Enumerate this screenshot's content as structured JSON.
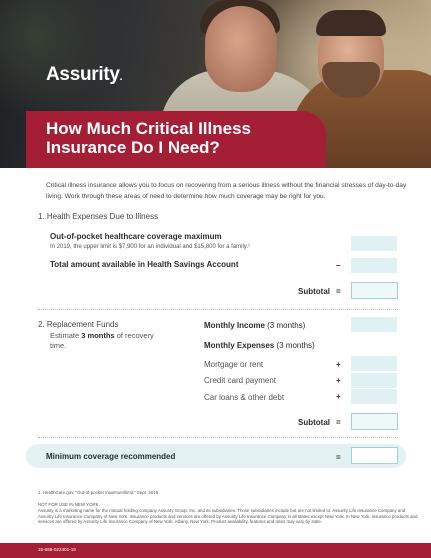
{
  "brand": {
    "logo_text": "Assurity",
    "accent_color": "#a41f35",
    "field_color": "#dff1f2"
  },
  "hero": {
    "title": "How Much Critical Illness Insurance Do I Need?",
    "image_alt": "Two men smiling"
  },
  "intro": "Critical illness insurance allows you to focus on recovering from a serious illness without the financial stresses of day-to-day living. Work through these areas of need to determine how much coverage may be right for you.",
  "section1": {
    "heading": "1. Health Expenses Due to Illness",
    "oop_label": "Out-of-pocket healthcare coverage maximum",
    "oop_note": "In 2019, the upper limit is $7,900 for an individual and $15,800 for a family.¹",
    "hsa_label": "Total amount available in Health Savings Account",
    "minus_sign": "–",
    "subtotal_label": "Subtotal",
    "equals_sign": "="
  },
  "section2": {
    "heading": "2. Replacement Funds",
    "estimate_prefix": "Estimate ",
    "estimate_bold": "3 months",
    "estimate_suffix": " of recovery time.",
    "monthly_income_bold": "Monthly Income",
    "monthly_income_suffix": " (3 months)",
    "monthly_expenses_bold": "Monthly Expenses",
    "monthly_expenses_suffix": " (3 months)",
    "items": [
      {
        "label": "Mortgage or rent",
        "sign": "+"
      },
      {
        "label": "Credit card payment",
        "sign": "+"
      },
      {
        "label": "Car loans & other debt",
        "sign": "+"
      }
    ],
    "subtotal_label": "Subtotal",
    "equals_sign": "="
  },
  "minimum": {
    "label": "Minimum coverage recommended",
    "equals_sign": "="
  },
  "footnote": "1. HealthCare.gov, \"Out-of-pocket maximum/limit,\" Sept. 2019",
  "legal_title": "NOT FOR USE IN NEW YORK.",
  "legal_text": "Assurity is a marketing name for the mutual holding company Assurity Group, Inc. and its subsidiaries. Those subsidiaries include but are not limited to: Assurity Life Insurance Company and Assurity Life Insurance Company of New York. Insurance products and services are offered by Assurity Life Insurance Company in all states except New York. In New York, insurance products and services are offered by Assurity Life Insurance Company of New York, Albany, New York. Product availability, features and rates may vary by state.",
  "footer_code": "15-668-022401-19"
}
